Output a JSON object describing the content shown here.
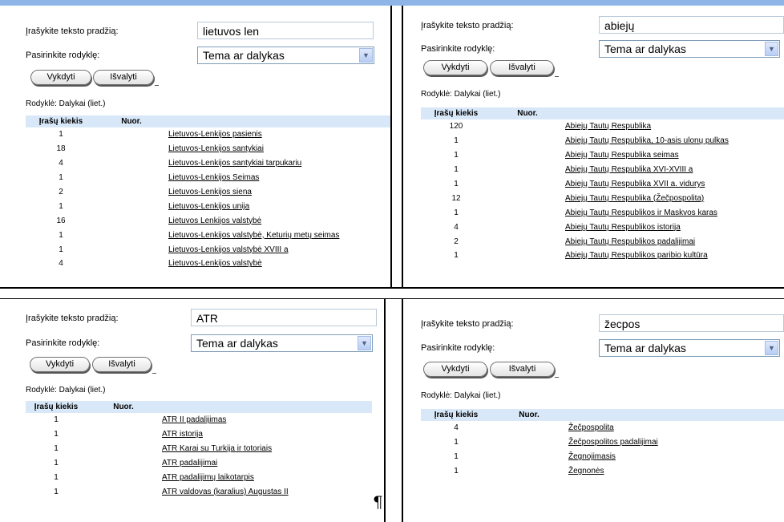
{
  "panels": [
    {
      "label_text": "Įrašykite teksto pradžią:",
      "label_index": "Pasirinkite rodyklę:",
      "input_value": "lietuvos len",
      "index_value": "Tema ar dalykas",
      "button_go": "Vykdyti",
      "button_clear": "Išvalyti",
      "index_caption": "Rodyklė: Dalykai (liet.)",
      "col_count": "Įrašų kiekis",
      "col_ref": "Nuor.",
      "rows": [
        {
          "count": "1",
          "term": "Lietuvos-Lenkijos pasienis"
        },
        {
          "count": "18",
          "term": "Lietuvos-Lenkijos santykiai"
        },
        {
          "count": "4",
          "term": "Lietuvos-Lenkijos santykiai tarpukariu"
        },
        {
          "count": "1",
          "term": "Lietuvos-Lenkijos Seimas"
        },
        {
          "count": "2",
          "term": "Lietuvos-Lenkijos siena"
        },
        {
          "count": "1",
          "term": "Lietuvos-Lenkijos unija"
        },
        {
          "count": "16",
          "term": "Lietuvos Lenkijos valstybė"
        },
        {
          "count": "1",
          "term": "Lietuvos-Lenkijos valstybė, Keturių metų seimas"
        },
        {
          "count": "1",
          "term": "Lietuvos-Lenkijos valstybė XVIII a"
        },
        {
          "count": "4",
          "term": "Lietuvos-Lenkijos valstybė"
        }
      ]
    },
    {
      "label_text": "Įrašykite teksto pradžią:",
      "label_index": "Pasirinkite rodyklę:",
      "input_value": "abiejų",
      "index_value": "Tema ar dalykas",
      "button_go": "Vykdyti",
      "button_clear": "Išvalyti",
      "index_caption": "Rodyklė: Dalykai (liet.)",
      "col_count": "Įrašų kiekis",
      "col_ref": "Nuor.",
      "rows": [
        {
          "count": "120",
          "term": "Abiejų Tautų Respublika"
        },
        {
          "count": "1",
          "term": "Abiejų Tautų Respublika, 10-asis ulonų pulkas"
        },
        {
          "count": "1",
          "term": "Abiejų Tautų Respublika seimas"
        },
        {
          "count": "1",
          "term": "Abiejų Tautų Respublika XVI-XVIII a"
        },
        {
          "count": "1",
          "term": "Abiejų Tautų Respublika XVII a. vidurys"
        },
        {
          "count": "12",
          "term": "Abiejų Tautų Respublika (Žečpospolita)"
        },
        {
          "count": "1",
          "term": "Abiejų Tautų Respublikos ir Maskvos karas"
        },
        {
          "count": "4",
          "term": "Abiejų Tautų Respublikos istorija"
        },
        {
          "count": "2",
          "term": "Abiejų Tautų Respublikos padalijimai"
        },
        {
          "count": "1",
          "term": "Abiejų Tautų Respublikos paribio kultūra"
        }
      ]
    },
    {
      "label_text": "Įrašykite teksto pradžią:",
      "label_index": "Pasirinkite rodyklę:",
      "input_value": "ATR",
      "index_value": "Tema ar dalykas",
      "button_go": "Vykdyti",
      "button_clear": "Išvalyti",
      "index_caption": "Rodyklė: Dalykai (liet.)",
      "col_count": "Įrašų kiekis",
      "col_ref": "Nuor.",
      "rows": [
        {
          "count": "1",
          "term": "ATR II padalijimas"
        },
        {
          "count": "1",
          "term": "ATR istorija"
        },
        {
          "count": "1",
          "term": "ATR Karai su Turkija ir totoriais"
        },
        {
          "count": "1",
          "term": "ATR padalijimai"
        },
        {
          "count": "1",
          "term": "ATR padalijimų laikotarpis"
        },
        {
          "count": "1",
          "term": "ATR valdovas (karalius) Augustas II"
        }
      ]
    },
    {
      "label_text": "Įrašykite teksto pradžią:",
      "label_index": "Pasirinkite rodyklę:",
      "input_value": "žecpos",
      "index_value": "Tema ar dalykas",
      "button_go": "Vykdyti",
      "button_clear": "Išvalyti",
      "index_caption": "Rodyklė: Dalykai (liet.)",
      "col_count": "Įrašų kiekis",
      "col_ref": "Nuor.",
      "rows": [
        {
          "count": "4",
          "term": "Žečpospolita"
        },
        {
          "count": "1",
          "term": "Žečpospolitos padalijimai"
        },
        {
          "count": "1",
          "term": "Žegnojimasis"
        },
        {
          "count": "1",
          "term": "Žegnonės"
        }
      ]
    }
  ],
  "pilcrow": "¶"
}
